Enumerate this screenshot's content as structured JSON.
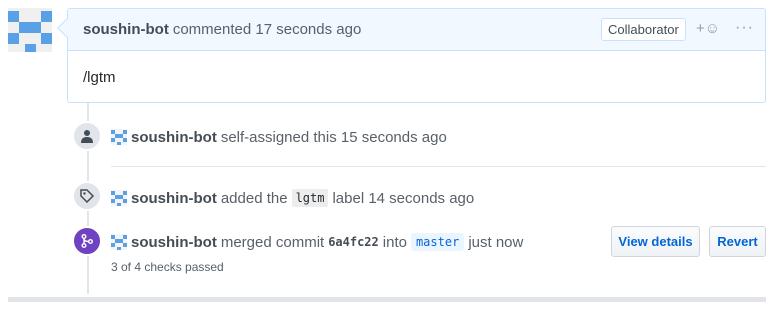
{
  "comment": {
    "author": "soushin-bot",
    "action": "commented",
    "time": "17 seconds ago",
    "role_badge": "Collaborator",
    "reaction_label": "+☺",
    "more_label": "···",
    "body": "/lgtm"
  },
  "events": [
    {
      "author": "soushin-bot",
      "text": "self-assigned this 15 seconds ago"
    },
    {
      "author": "soushin-bot",
      "text_before": "added the",
      "label": "lgtm",
      "text_after": "label 14 seconds ago"
    },
    {
      "author": "soushin-bot",
      "text_before": "merged commit",
      "sha": "6a4fc22",
      "text_mid": "into",
      "branch": "master",
      "text_after": "just now",
      "checks": "3 of 4 checks passed",
      "view_details": "View details",
      "revert": "Revert"
    }
  ],
  "colors": {
    "accent": "#0366d6",
    "merged": "#6f42c1",
    "comment_border": "#c8e1ff",
    "comment_header_bg": "#f1f8ff",
    "identicon": "#5aa0e6"
  },
  "icons": [
    "person-icon",
    "tag-icon",
    "git-merge-icon",
    "add-reaction-icon",
    "kebab-icon"
  ]
}
